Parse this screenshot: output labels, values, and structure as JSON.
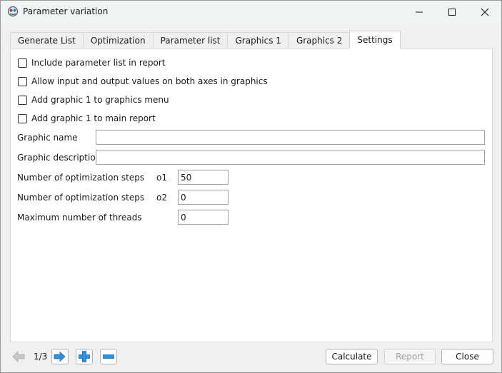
{
  "window": {
    "title": "Parameter variation",
    "icon": "app-icon"
  },
  "tabs": [
    {
      "label": "Generate List",
      "active": false
    },
    {
      "label": "Optimization",
      "active": false
    },
    {
      "label": "Parameter list",
      "active": false
    },
    {
      "label": "Graphics 1",
      "active": false
    },
    {
      "label": "Graphics 2",
      "active": false
    },
    {
      "label": "Settings",
      "active": true
    }
  ],
  "settings": {
    "checkboxes": [
      {
        "label": "Include parameter list in report",
        "checked": false
      },
      {
        "label": "Allow input and output values on both axes in graphics",
        "checked": false
      },
      {
        "label": "Add graphic 1 to graphics menu",
        "checked": false
      },
      {
        "label": "Add graphic 1 to main report",
        "checked": false
      }
    ],
    "graphic_name": {
      "label": "Graphic name",
      "value": ""
    },
    "graphic_description": {
      "label": "Graphic description",
      "value": ""
    },
    "opt_steps_o1": {
      "label": "Number of optimization steps",
      "sublabel": "o1",
      "value": "50"
    },
    "opt_steps_o2": {
      "label": "Number of optimization steps",
      "sublabel": "o2",
      "value": "0"
    },
    "max_threads": {
      "label": "Maximum number of threads",
      "value": "0"
    }
  },
  "footer": {
    "page_indicator": "1/3",
    "calculate_label": "Calculate",
    "report_label": "Report",
    "close_label": "Close"
  }
}
